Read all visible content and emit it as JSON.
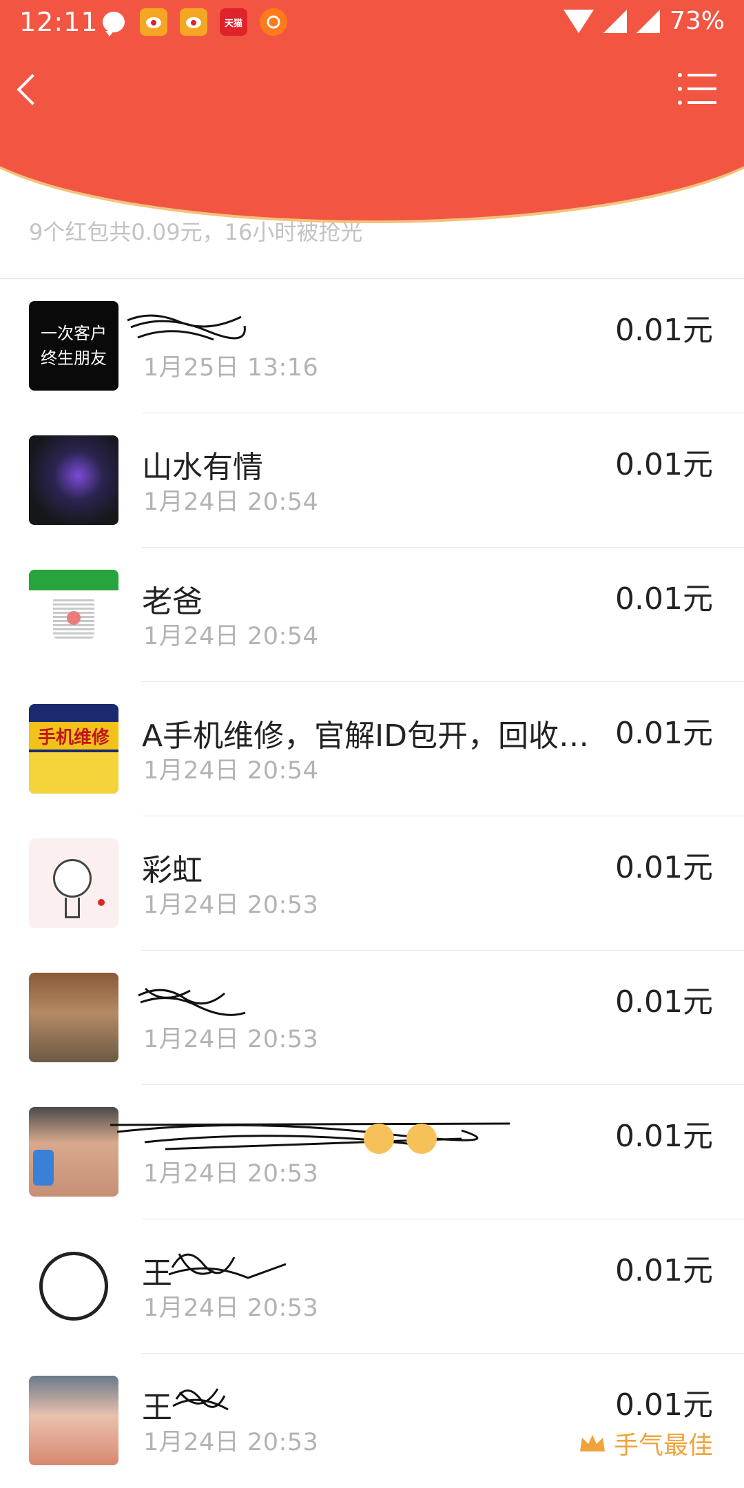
{
  "status_bar": {
    "time": "12:11",
    "battery": "73%",
    "notification_icons": [
      "chat-icon",
      "weibo-icon",
      "weibo-icon",
      "tmall-icon",
      "orange-app-icon"
    ],
    "tmall_label": "天猫"
  },
  "nav": {
    "back_icon": "chevron-left-icon",
    "menu_icon": "list-menu-icon"
  },
  "colors": {
    "header_red": "#f25643",
    "gold": "#f1a33b",
    "text_primary": "#222222",
    "text_secondary": "#b3b3b3"
  },
  "summary": "9个红包共0.09元，16小时被抢光",
  "items": [
    {
      "name": "",
      "time": "1月25日  13:16",
      "amount": "0.01元",
      "avatar_text": [
        "一次客户",
        "终生朋友"
      ]
    },
    {
      "name": "山水有情",
      "time": "1月24日  20:54",
      "amount": "0.01元"
    },
    {
      "name": "老爸",
      "time": "1月24日  20:54",
      "amount": "0.01元"
    },
    {
      "name": "A手机维修，官解ID包开，回收…",
      "time": "1月24日  20:54",
      "amount": "0.01元",
      "avatar_text": [
        "手机维修"
      ]
    },
    {
      "name": "彩虹",
      "time": "1月24日  20:53",
      "amount": "0.01元"
    },
    {
      "name": "",
      "time": "1月24日  20:53",
      "amount": "0.01元"
    },
    {
      "name": "",
      "time": "1月24日  20:53",
      "amount": "0.01元"
    },
    {
      "name": "王",
      "time": "1月24日  20:53",
      "amount": "0.01元"
    },
    {
      "name": "王",
      "time": "1月24日  20:53",
      "amount": "0.01元",
      "badge": "手气最佳"
    }
  ]
}
